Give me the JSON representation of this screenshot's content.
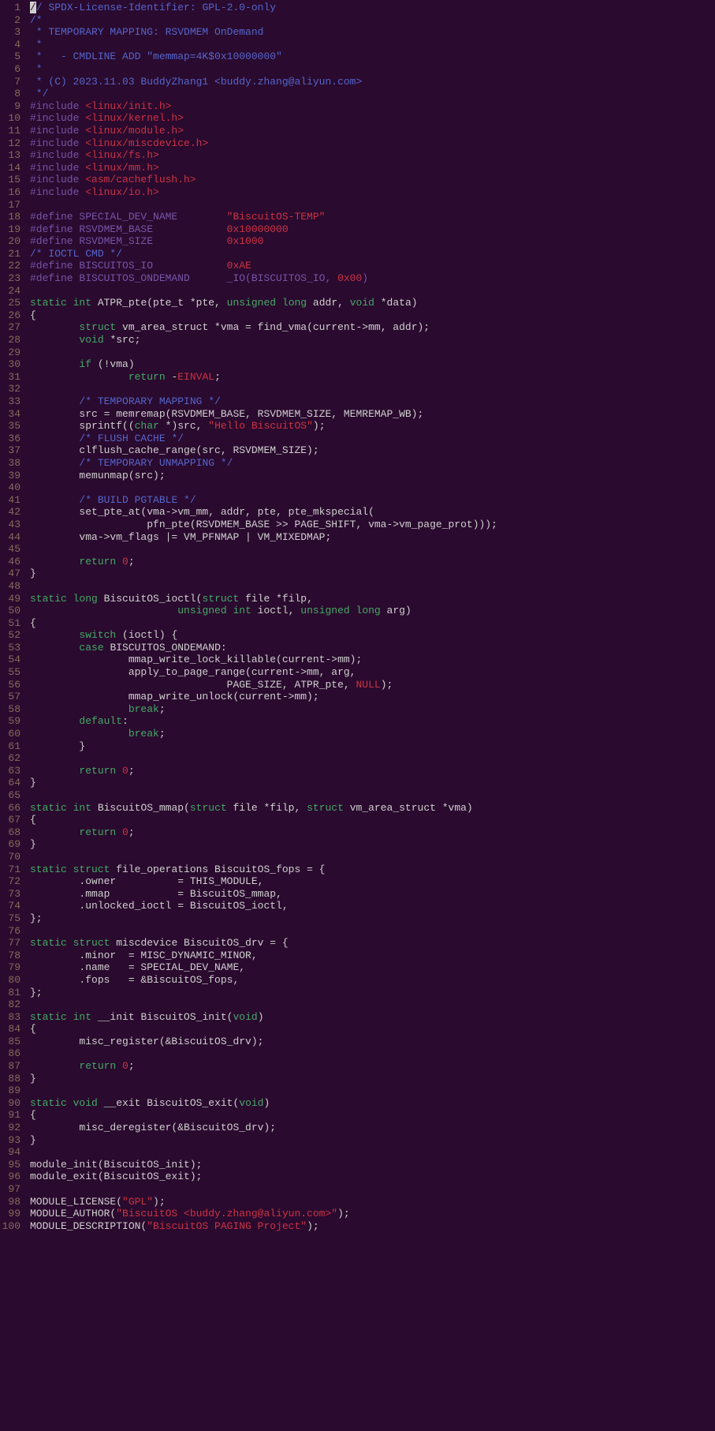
{
  "file": {
    "language": "c",
    "total_lines": 100,
    "line_numbers": [
      "1",
      "2",
      "3",
      "4",
      "5",
      "6",
      "7",
      "8",
      "9",
      "10",
      "11",
      "12",
      "13",
      "14",
      "15",
      "16",
      "17",
      "18",
      "19",
      "20",
      "21",
      "22",
      "23",
      "24",
      "25",
      "26",
      "27",
      "28",
      "29",
      "30",
      "31",
      "32",
      "33",
      "34",
      "35",
      "36",
      "37",
      "38",
      "39",
      "40",
      "41",
      "42",
      "43",
      "44",
      "45",
      "46",
      "47",
      "48",
      "49",
      "50",
      "51",
      "52",
      "53",
      "54",
      "55",
      "56",
      "57",
      "58",
      "59",
      "60",
      "61",
      "62",
      "63",
      "64",
      "65",
      "66",
      "67",
      "68",
      "69",
      "70",
      "71",
      "72",
      "73",
      "74",
      "75",
      "76",
      "77",
      "78",
      "79",
      "80",
      "81",
      "82",
      "83",
      "84",
      "85",
      "86",
      "87",
      "88",
      "89",
      "90",
      "91",
      "92",
      "93",
      "94",
      "95",
      "96",
      "97",
      "98",
      "99",
      "100"
    ]
  },
  "code_lines": [
    [
      [
        "cursor",
        "/"
      ],
      [
        "comment",
        "/ SPDX-License-Identifier: GPL-2.0-only"
      ]
    ],
    [
      [
        "comment",
        "/*"
      ]
    ],
    [
      [
        "comment",
        " * TEMPORARY MAPPING: RSVDMEM OnDemand"
      ]
    ],
    [
      [
        "comment",
        " *"
      ]
    ],
    [
      [
        "comment",
        " *   - CMDLINE ADD \"memmap=4K$0x10000000\""
      ]
    ],
    [
      [
        "comment",
        " *"
      ]
    ],
    [
      [
        "comment",
        " * (C) 2023.11.03 BuddyZhang1 <buddy.zhang@aliyun.com>"
      ]
    ],
    [
      [
        "comment",
        " */"
      ]
    ],
    [
      [
        "preproc",
        "#include "
      ],
      [
        "string",
        "<linux/init.h>"
      ]
    ],
    [
      [
        "preproc",
        "#include "
      ],
      [
        "string",
        "<linux/kernel.h>"
      ]
    ],
    [
      [
        "preproc",
        "#include "
      ],
      [
        "string",
        "<linux/module.h>"
      ]
    ],
    [
      [
        "preproc",
        "#include "
      ],
      [
        "string",
        "<linux/miscdevice.h>"
      ]
    ],
    [
      [
        "preproc",
        "#include "
      ],
      [
        "string",
        "<linux/fs.h>"
      ]
    ],
    [
      [
        "preproc",
        "#include "
      ],
      [
        "string",
        "<linux/mm.h>"
      ]
    ],
    [
      [
        "preproc",
        "#include "
      ],
      [
        "string",
        "<asm/cacheflush.h>"
      ]
    ],
    [
      [
        "preproc",
        "#include "
      ],
      [
        "string",
        "<linux/io.h>"
      ]
    ],
    [],
    [
      [
        "preproc",
        "#define SPECIAL_DEV_NAME        "
      ],
      [
        "string",
        "\"BiscuitOS-TEMP\""
      ]
    ],
    [
      [
        "preproc",
        "#define RSVDMEM_BASE            "
      ],
      [
        "number",
        "0x10000000"
      ]
    ],
    [
      [
        "preproc",
        "#define RSVDMEM_SIZE            "
      ],
      [
        "number",
        "0x1000"
      ]
    ],
    [
      [
        "comment",
        "/* IOCTL CMD */"
      ]
    ],
    [
      [
        "preproc",
        "#define BISCUITOS_IO            "
      ],
      [
        "number",
        "0xAE"
      ]
    ],
    [
      [
        "preproc",
        "#define BISCUITOS_ONDEMAND      _IO(BISCUITOS_IO, "
      ],
      [
        "number",
        "0x00"
      ],
      [
        "preproc",
        ")"
      ]
    ],
    [],
    [
      [
        "keyword",
        "static"
      ],
      [
        "ident",
        " "
      ],
      [
        "keyword",
        "int"
      ],
      [
        "ident",
        " ATPR_pte(pte_t *pte, "
      ],
      [
        "keyword",
        "unsigned"
      ],
      [
        "ident",
        " "
      ],
      [
        "keyword",
        "long"
      ],
      [
        "ident",
        " addr, "
      ],
      [
        "keyword",
        "void"
      ],
      [
        "ident",
        " *data)"
      ]
    ],
    [
      [
        "ident",
        "{"
      ]
    ],
    [
      [
        "ident",
        "        "
      ],
      [
        "keyword",
        "struct"
      ],
      [
        "ident",
        " vm_area_struct *vma = find_vma(current->mm, addr);"
      ]
    ],
    [
      [
        "ident",
        "        "
      ],
      [
        "keyword",
        "void"
      ],
      [
        "ident",
        " *src;"
      ]
    ],
    [],
    [
      [
        "ident",
        "        "
      ],
      [
        "keyword",
        "if"
      ],
      [
        "ident",
        " (!vma)"
      ]
    ],
    [
      [
        "ident",
        "                "
      ],
      [
        "keyword",
        "return"
      ],
      [
        "ident",
        " -"
      ],
      [
        "number",
        "EINVAL"
      ],
      [
        "ident",
        ";"
      ]
    ],
    [],
    [
      [
        "ident",
        "        "
      ],
      [
        "comment",
        "/* TEMPORARY MAPPING */"
      ]
    ],
    [
      [
        "ident",
        "        src = memremap(RSVDMEM_BASE, RSVDMEM_SIZE, MEMREMAP_WB);"
      ]
    ],
    [
      [
        "ident",
        "        sprintf(("
      ],
      [
        "keyword",
        "char"
      ],
      [
        "ident",
        " *)src, "
      ],
      [
        "string",
        "\"Hello BiscuitOS\""
      ],
      [
        "ident",
        ");"
      ]
    ],
    [
      [
        "ident",
        "        "
      ],
      [
        "comment",
        "/* FLUSH CACHE */"
      ]
    ],
    [
      [
        "ident",
        "        clflush_cache_range(src, RSVDMEM_SIZE);"
      ]
    ],
    [
      [
        "ident",
        "        "
      ],
      [
        "comment",
        "/* TEMPORARY UNMAPPING */"
      ]
    ],
    [
      [
        "ident",
        "        memunmap(src);"
      ]
    ],
    [],
    [
      [
        "ident",
        "        "
      ],
      [
        "comment",
        "/* BUILD PGTABLE */"
      ]
    ],
    [
      [
        "ident",
        "        set_pte_at(vma->vm_mm, addr, pte, pte_mkspecial("
      ]
    ],
    [
      [
        "ident",
        "                   pfn_pte(RSVDMEM_BASE >> PAGE_SHIFT, vma->vm_page_prot)));"
      ]
    ],
    [
      [
        "ident",
        "        vma->vm_flags |= VM_PFNMAP | VM_MIXEDMAP;"
      ]
    ],
    [],
    [
      [
        "ident",
        "        "
      ],
      [
        "keyword",
        "return"
      ],
      [
        "ident",
        " "
      ],
      [
        "number",
        "0"
      ],
      [
        "ident",
        ";"
      ]
    ],
    [
      [
        "ident",
        "}"
      ]
    ],
    [],
    [
      [
        "keyword",
        "static"
      ],
      [
        "ident",
        " "
      ],
      [
        "keyword",
        "long"
      ],
      [
        "ident",
        " BiscuitOS_ioctl("
      ],
      [
        "keyword",
        "struct"
      ],
      [
        "ident",
        " file *filp,"
      ]
    ],
    [
      [
        "ident",
        "                        "
      ],
      [
        "keyword",
        "unsigned"
      ],
      [
        "ident",
        " "
      ],
      [
        "keyword",
        "int"
      ],
      [
        "ident",
        " ioctl, "
      ],
      [
        "keyword",
        "unsigned"
      ],
      [
        "ident",
        " "
      ],
      [
        "keyword",
        "long"
      ],
      [
        "ident",
        " arg)"
      ]
    ],
    [
      [
        "ident",
        "{"
      ]
    ],
    [
      [
        "ident",
        "        "
      ],
      [
        "keyword",
        "switch"
      ],
      [
        "ident",
        " (ioctl) {"
      ]
    ],
    [
      [
        "ident",
        "        "
      ],
      [
        "keyword",
        "case"
      ],
      [
        "ident",
        " BISCUITOS_ONDEMAND:"
      ]
    ],
    [
      [
        "ident",
        "                mmap_write_lock_killable(current->mm);"
      ]
    ],
    [
      [
        "ident",
        "                apply_to_page_range(current->mm, arg,"
      ]
    ],
    [
      [
        "ident",
        "                                PAGE_SIZE, ATPR_pte, "
      ],
      [
        "number",
        "NULL"
      ],
      [
        "ident",
        ");"
      ]
    ],
    [
      [
        "ident",
        "                mmap_write_unlock(current->mm);"
      ]
    ],
    [
      [
        "ident",
        "                "
      ],
      [
        "keyword",
        "break"
      ],
      [
        "ident",
        ";"
      ]
    ],
    [
      [
        "ident",
        "        "
      ],
      [
        "keyword",
        "default"
      ],
      [
        "ident",
        ":"
      ]
    ],
    [
      [
        "ident",
        "                "
      ],
      [
        "keyword",
        "break"
      ],
      [
        "ident",
        ";"
      ]
    ],
    [
      [
        "ident",
        "        }"
      ]
    ],
    [],
    [
      [
        "ident",
        "        "
      ],
      [
        "keyword",
        "return"
      ],
      [
        "ident",
        " "
      ],
      [
        "number",
        "0"
      ],
      [
        "ident",
        ";"
      ]
    ],
    [
      [
        "ident",
        "}"
      ]
    ],
    [],
    [
      [
        "keyword",
        "static"
      ],
      [
        "ident",
        " "
      ],
      [
        "keyword",
        "int"
      ],
      [
        "ident",
        " BiscuitOS_mmap("
      ],
      [
        "keyword",
        "struct"
      ],
      [
        "ident",
        " file *filp, "
      ],
      [
        "keyword",
        "struct"
      ],
      [
        "ident",
        " vm_area_struct *vma)"
      ]
    ],
    [
      [
        "ident",
        "{"
      ]
    ],
    [
      [
        "ident",
        "        "
      ],
      [
        "keyword",
        "return"
      ],
      [
        "ident",
        " "
      ],
      [
        "number",
        "0"
      ],
      [
        "ident",
        ";"
      ]
    ],
    [
      [
        "ident",
        "}"
      ]
    ],
    [],
    [
      [
        "keyword",
        "static"
      ],
      [
        "ident",
        " "
      ],
      [
        "keyword",
        "struct"
      ],
      [
        "ident",
        " file_operations BiscuitOS_fops = {"
      ]
    ],
    [
      [
        "ident",
        "        .owner          = THIS_MODULE,"
      ]
    ],
    [
      [
        "ident",
        "        .mmap           = BiscuitOS_mmap,"
      ]
    ],
    [
      [
        "ident",
        "        .unlocked_ioctl = BiscuitOS_ioctl,"
      ]
    ],
    [
      [
        "ident",
        "};"
      ]
    ],
    [],
    [
      [
        "keyword",
        "static"
      ],
      [
        "ident",
        " "
      ],
      [
        "keyword",
        "struct"
      ],
      [
        "ident",
        " miscdevice BiscuitOS_drv = {"
      ]
    ],
    [
      [
        "ident",
        "        .minor  = MISC_DYNAMIC_MINOR,"
      ]
    ],
    [
      [
        "ident",
        "        .name   = SPECIAL_DEV_NAME,"
      ]
    ],
    [
      [
        "ident",
        "        .fops   = &BiscuitOS_fops,"
      ]
    ],
    [
      [
        "ident",
        "};"
      ]
    ],
    [],
    [
      [
        "keyword",
        "static"
      ],
      [
        "ident",
        " "
      ],
      [
        "keyword",
        "int"
      ],
      [
        "ident",
        " __init BiscuitOS_init("
      ],
      [
        "keyword",
        "void"
      ],
      [
        "ident",
        ")"
      ]
    ],
    [
      [
        "ident",
        "{"
      ]
    ],
    [
      [
        "ident",
        "        misc_register(&BiscuitOS_drv);"
      ]
    ],
    [],
    [
      [
        "ident",
        "        "
      ],
      [
        "keyword",
        "return"
      ],
      [
        "ident",
        " "
      ],
      [
        "number",
        "0"
      ],
      [
        "ident",
        ";"
      ]
    ],
    [
      [
        "ident",
        "}"
      ]
    ],
    [],
    [
      [
        "keyword",
        "static"
      ],
      [
        "ident",
        " "
      ],
      [
        "keyword",
        "void"
      ],
      [
        "ident",
        " __exit BiscuitOS_exit("
      ],
      [
        "keyword",
        "void"
      ],
      [
        "ident",
        ")"
      ]
    ],
    [
      [
        "ident",
        "{"
      ]
    ],
    [
      [
        "ident",
        "        misc_deregister(&BiscuitOS_drv);"
      ]
    ],
    [
      [
        "ident",
        "}"
      ]
    ],
    [],
    [
      [
        "ident",
        "module_init(BiscuitOS_init);"
      ]
    ],
    [
      [
        "ident",
        "module_exit(BiscuitOS_exit);"
      ]
    ],
    [],
    [
      [
        "ident",
        "MODULE_LICENSE("
      ],
      [
        "string",
        "\"GPL\""
      ],
      [
        "ident",
        ");"
      ]
    ],
    [
      [
        "ident",
        "MODULE_AUTHOR("
      ],
      [
        "string",
        "\"BiscuitOS <buddy.zhang@aliyun.com>\""
      ],
      [
        "ident",
        ");"
      ]
    ],
    [
      [
        "ident",
        "MODULE_DESCRIPTION("
      ],
      [
        "string",
        "\"BiscuitOS PAGING Project\""
      ],
      [
        "ident",
        ");"
      ]
    ]
  ],
  "token_classes": {
    "comment": "c-comment",
    "string": "c-string",
    "preproc": "c-preproc",
    "keyword": "c-keyword",
    "number": "c-number",
    "ident": "c-ident",
    "func": "c-func",
    "type": "c-type",
    "cursor": "c-cursor"
  }
}
